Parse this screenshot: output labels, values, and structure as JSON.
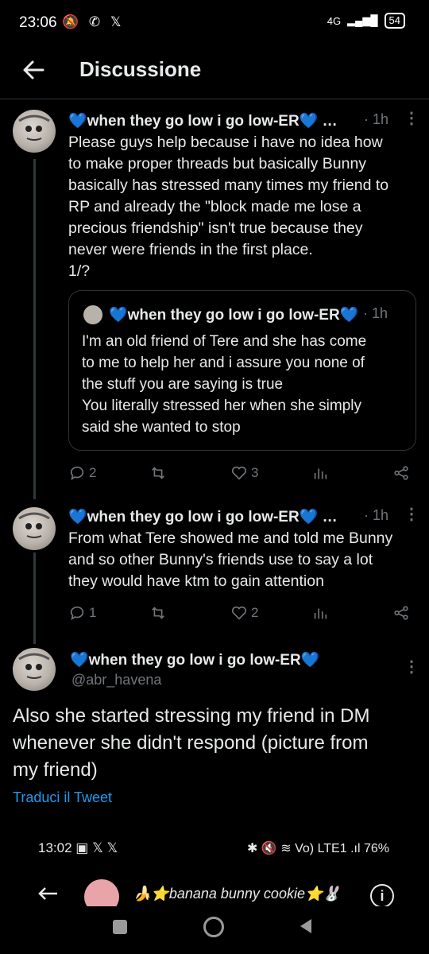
{
  "status_bar": {
    "time": "23:06",
    "icons": "🔕 ✆ 𝕏",
    "network": "4G",
    "battery": "54"
  },
  "header": {
    "title": "Discussione"
  },
  "tweets": [
    {
      "author": "💙when they go low i go low-ER💙 …",
      "time": "· 1h",
      "text": "Please guys help because i have no idea how\nto make proper threads but basically Bunny\nbasically has stressed many times my friend to\nRP and already the \"block made me lose a\nprecious friendship\" isn't true because they\nnever were friends in the first place.\n1/?",
      "quote": {
        "author": "💙when they go low i go low-ER💙",
        "time": "· 1h",
        "text": "I'm an old friend of Tere and she has come\nto me to help her and i assure you none of\nthe stuff you are saying is true\nYou literally stressed her when she simply\nsaid she wanted to stop"
      },
      "replies": "2",
      "retweets": "",
      "likes": "3"
    },
    {
      "author": "💙when they go low i go low-ER💙 …",
      "time": "· 1h",
      "text": "From what Tere showed me and told me Bunny\nand so other Bunny's friends use to say a lot\nthey would have ktm to gain attention",
      "replies": "1",
      "retweets": "",
      "likes": "2"
    }
  ],
  "main_tweet": {
    "author": "💙when they go low i go low-ER💙",
    "handle": "@abr_havena",
    "text": "Also she started stressing my friend in DM\nwhenever she didn't respond (picture from\nmy friend)",
    "translate": "Traduci il Tweet"
  },
  "embedded": {
    "time": "13:02",
    "left_icons": "▣ 𝕏 𝕏",
    "right_icons": "✱ 🔇 ≋ Vo) LTE1 .ıl",
    "battery": "76%",
    "profile_name": "🍌⭐banana bunny cookie⭐🐰"
  },
  "colors": {
    "accent": "#1d9bf0",
    "heart": "#49b6f2",
    "muted": "#71767b"
  }
}
